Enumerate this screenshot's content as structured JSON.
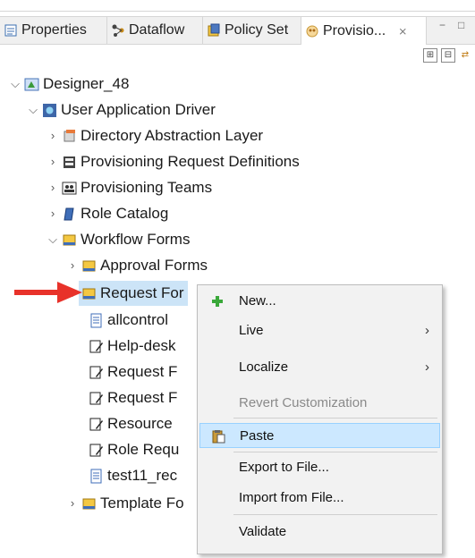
{
  "tabs": [
    {
      "label": "Properties",
      "icon": "properties-icon"
    },
    {
      "label": "Dataflow",
      "icon": "dataflow-icon"
    },
    {
      "label": "Policy Set",
      "icon": "policy-set-icon"
    },
    {
      "label": "Provisio...",
      "icon": "provisioning-icon",
      "active": true,
      "close": "⨯"
    }
  ],
  "tab_controls": {
    "minimize": "−",
    "maximize": "□"
  },
  "toolbar": {
    "expand": "⊞",
    "collapse": "⊟",
    "sync": "⇄"
  },
  "tree": {
    "root": {
      "label": "Designer_48"
    },
    "driver": {
      "label": "User Application Driver"
    },
    "dal": {
      "label": "Directory Abstraction Layer"
    },
    "prd": {
      "label": "Provisioning Request Definitions"
    },
    "teams": {
      "label": "Provisioning Teams"
    },
    "roles": {
      "label": "Role Catalog"
    },
    "wf": {
      "label": "Workflow Forms"
    },
    "approval": {
      "label": "Approval Forms"
    },
    "request": {
      "label": "Request For"
    },
    "children": [
      "allcontrol",
      "Help-desk",
      "Request F",
      "Request F",
      "Resource",
      "Role Requ",
      "test11_rec"
    ],
    "template": {
      "label": "Template Fo"
    }
  },
  "context_menu": {
    "new": "New...",
    "live": "Live",
    "localize": "Localize",
    "revert": "Revert Customization",
    "paste": "Paste",
    "export": "Export to File...",
    "import": "Import from File...",
    "validate": "Validate"
  },
  "colors": {
    "selection": "#cce4f7",
    "menu_highlight": "#cce8ff",
    "annotation_arrow": "#e8322a"
  }
}
